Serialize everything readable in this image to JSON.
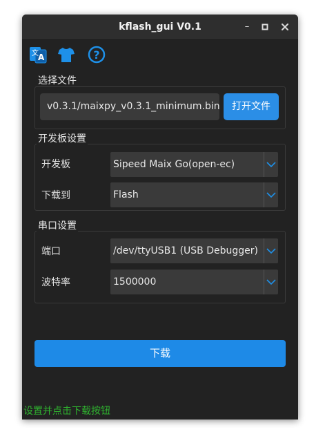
{
  "window": {
    "title": "kflash_gui V0.1",
    "controls": {
      "minimize": "–",
      "maximize": "□",
      "close": "✕"
    }
  },
  "toolbar": {
    "icons": [
      "translate-icon",
      "tshirt-icon",
      "help-icon"
    ],
    "accent_color": "#1e90e8"
  },
  "file_group": {
    "label": "选择文件",
    "file_path": "v0.3.1/maixpy_v0.3.1_minimum.bin",
    "open_button": "打开文件"
  },
  "board_group": {
    "label": "开发板设置",
    "board_label": "开发板",
    "board_value": "Sipeed Maix Go(open-ec)",
    "download_to_label": "下载到",
    "download_to_value": "Flash"
  },
  "serial_group": {
    "label": "串口设置",
    "port_label": "端口",
    "port_value": "/dev/ttyUSB1 (USB Debugger)",
    "baud_label": "波特率",
    "baud_value": "1500000"
  },
  "actions": {
    "download_button": "下载",
    "button_color": "#1e8ae7"
  },
  "status": {
    "text": "设置并点击下载按钮",
    "color": "#2fb32f"
  }
}
